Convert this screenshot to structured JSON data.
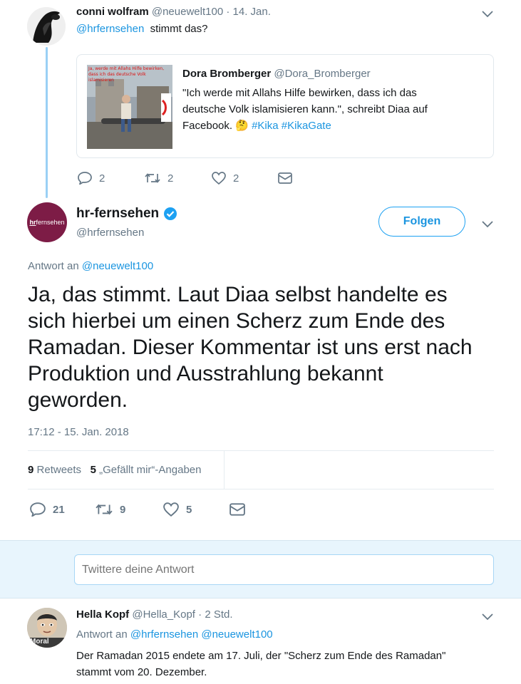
{
  "tweet1": {
    "name": "conni wolfram",
    "handle": "@neuewelt100",
    "sep": "·",
    "date": "14. Jan.",
    "mention": "@hrfernsehen",
    "text": "stimmt das?",
    "quote": {
      "name": "Dora Bromberger",
      "handle": "@Dora_Bromberger",
      "thumb_caption": "Ja, werde mit Allahs Hilfe bewirken, dass ich das deutsche Volk islamisieren",
      "line1": "\"Ich werde mit Allahs Hilfe bewirken, dass ich das",
      "line2": "deutsche Volk islamisieren kann.\", schreibt Diaa auf",
      "line3_pre": "Facebook.",
      "emoji": "🤔",
      "hashtags": "#Kika #KikaGate"
    },
    "actions": {
      "replies": "2",
      "retweets": "2",
      "likes": "2"
    }
  },
  "main_tweet": {
    "avatar_text_hr": "hr",
    "avatar_text_rest": "fernsehen",
    "name": "hr-fernsehen",
    "handle": "@hrfernsehen",
    "follow_label": "Folgen",
    "reply_to_prefix": "Antwort an",
    "reply_to_handle": "@neuewelt100",
    "text_lines": [
      "Ja, das stimmt. Laut Diaa selbst handelte es",
      "sich hierbei um einen Scherz zum Ende des",
      "Ramadan. Dieser Kommentar ist uns erst nach",
      "Produktion und Ausstrahlung bekannt",
      "geworden."
    ],
    "timestamp": "17:12 - 15. Jan. 2018",
    "retweets_count": "9",
    "retweets_label": "Retweets",
    "likes_count": "5",
    "likes_label": "„Gefällt mir“-Angaben",
    "actions": {
      "replies": "21",
      "retweets": "9",
      "likes": "5"
    }
  },
  "reply_box": {
    "placeholder": "Twittere deine Antwort"
  },
  "reply": {
    "name": "Hella Kopf",
    "handle": "@Hella_Kopf",
    "sep": "·",
    "time": "2 Std.",
    "reply_to_prefix": "Antwort an",
    "reply_to_handles": "@hrfernsehen @neuewelt100",
    "text_line1": "Der Ramadan 2015 endete am 17. Juli, der \"Scherz zum Ende des Ramadan\"",
    "text_line2": "stammt vom 20. Dezember.",
    "avatar_text": "Moral"
  },
  "colors": {
    "accent": "#1da1f2",
    "link": "#1b95e0",
    "muted": "#657786",
    "brand": "#7d1c46",
    "verified": "#1da1f2"
  }
}
